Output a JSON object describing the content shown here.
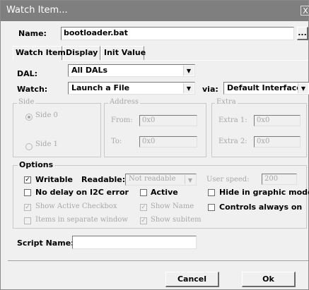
{
  "window": {
    "title": "Watch Item...",
    "close_glyph": "X"
  },
  "name_row": {
    "label": "Name:",
    "value": "bootloader.bat",
    "browse_label": "..."
  },
  "tabs": [
    {
      "label": "Watch Item"
    },
    {
      "label": "Display"
    },
    {
      "label": "Init Value"
    }
  ],
  "dal": {
    "label": "DAL:",
    "value": "All DALs"
  },
  "watch": {
    "label": "Watch:",
    "value": "Launch a File"
  },
  "via": {
    "label": "via:",
    "value": "Default Interface"
  },
  "side_group": {
    "title": "Side",
    "side0": "Side 0",
    "side1": "Side 1"
  },
  "address_group": {
    "title": "Address",
    "from_label": "From:",
    "from_value": "0x0",
    "to_label": "To:",
    "to_value": "0x0"
  },
  "extra_group": {
    "title": "Extra",
    "extra1_label": "Extra 1:",
    "extra1_value": "0x0",
    "extra2_label": "Extra 2:",
    "extra2_value": "0x0"
  },
  "options": {
    "title": "Options",
    "writable": "Writable",
    "readable_label": "Readable:",
    "readable_value": "Not readable",
    "user_speed_label": "User speed:",
    "user_speed_value": "200",
    "no_delay": "No delay on I2C error",
    "active": "Active",
    "hide_graphic": "Hide in graphic mode",
    "show_active_checkbox": "Show Active Checkbox",
    "show_name": "Show Name",
    "controls_always_on": "Controls always on",
    "items_separate_window": "Items in separate window",
    "show_subitem": "Show subitem"
  },
  "script": {
    "label": "Script Name:",
    "value": ""
  },
  "buttons": {
    "cancel": "Cancel",
    "ok": "Ok"
  },
  "glyphs": {
    "check": "✓",
    "down_arrow": "▼"
  }
}
